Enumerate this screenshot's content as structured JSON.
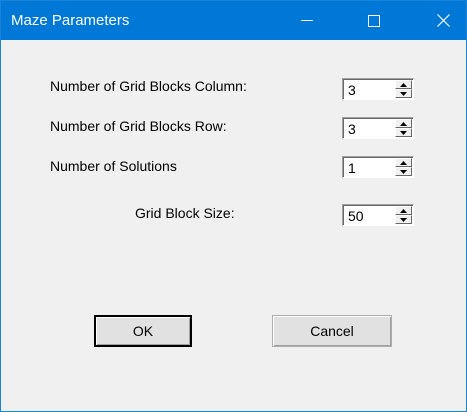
{
  "window": {
    "title": "Maze Parameters",
    "controls": {
      "minimize_icon": "minimize-icon",
      "maximize_icon": "maximize-icon",
      "close_icon": "close-icon"
    }
  },
  "fields": {
    "columns": {
      "label": "Number of Grid Blocks Column:",
      "value": "3"
    },
    "rows": {
      "label": "Number of Grid Blocks Row:",
      "value": "3"
    },
    "solutions": {
      "label": "Number of Solutions",
      "value": "1"
    },
    "block_size": {
      "label": "Grid Block Size:",
      "value": "50"
    }
  },
  "buttons": {
    "ok_label": "OK",
    "cancel_label": "Cancel"
  },
  "colors": {
    "titlebar": "#0078d7",
    "dialog_bg": "#f0f0f0"
  }
}
